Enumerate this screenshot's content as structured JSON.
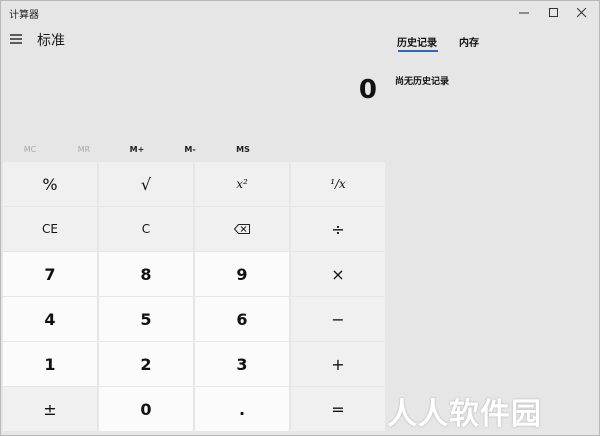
{
  "window": {
    "title": "计算器"
  },
  "header": {
    "mode_title": "标准",
    "display_value": "0"
  },
  "panel": {
    "tabs": [
      {
        "label": "历史记录",
        "active": true
      },
      {
        "label": "内存",
        "active": false
      }
    ],
    "empty_message": "尚无历史记录"
  },
  "memory": {
    "buttons": [
      "MC",
      "MR",
      "M+",
      "M-",
      "MS"
    ]
  },
  "keypad": {
    "keys": [
      "%",
      "√",
      "x²",
      "¹/x",
      "CE",
      "C",
      "⌫",
      "÷",
      "7",
      "8",
      "9",
      "×",
      "4",
      "5",
      "6",
      "−",
      "1",
      "2",
      "3",
      "+",
      "±",
      "0",
      ".",
      "="
    ]
  },
  "watermark": "人人软件园",
  "colors": {
    "background": "#e6e6e6",
    "key": "#f0f0f0",
    "number_key": "#fbfbfb",
    "accent": "#2b6cb0"
  }
}
